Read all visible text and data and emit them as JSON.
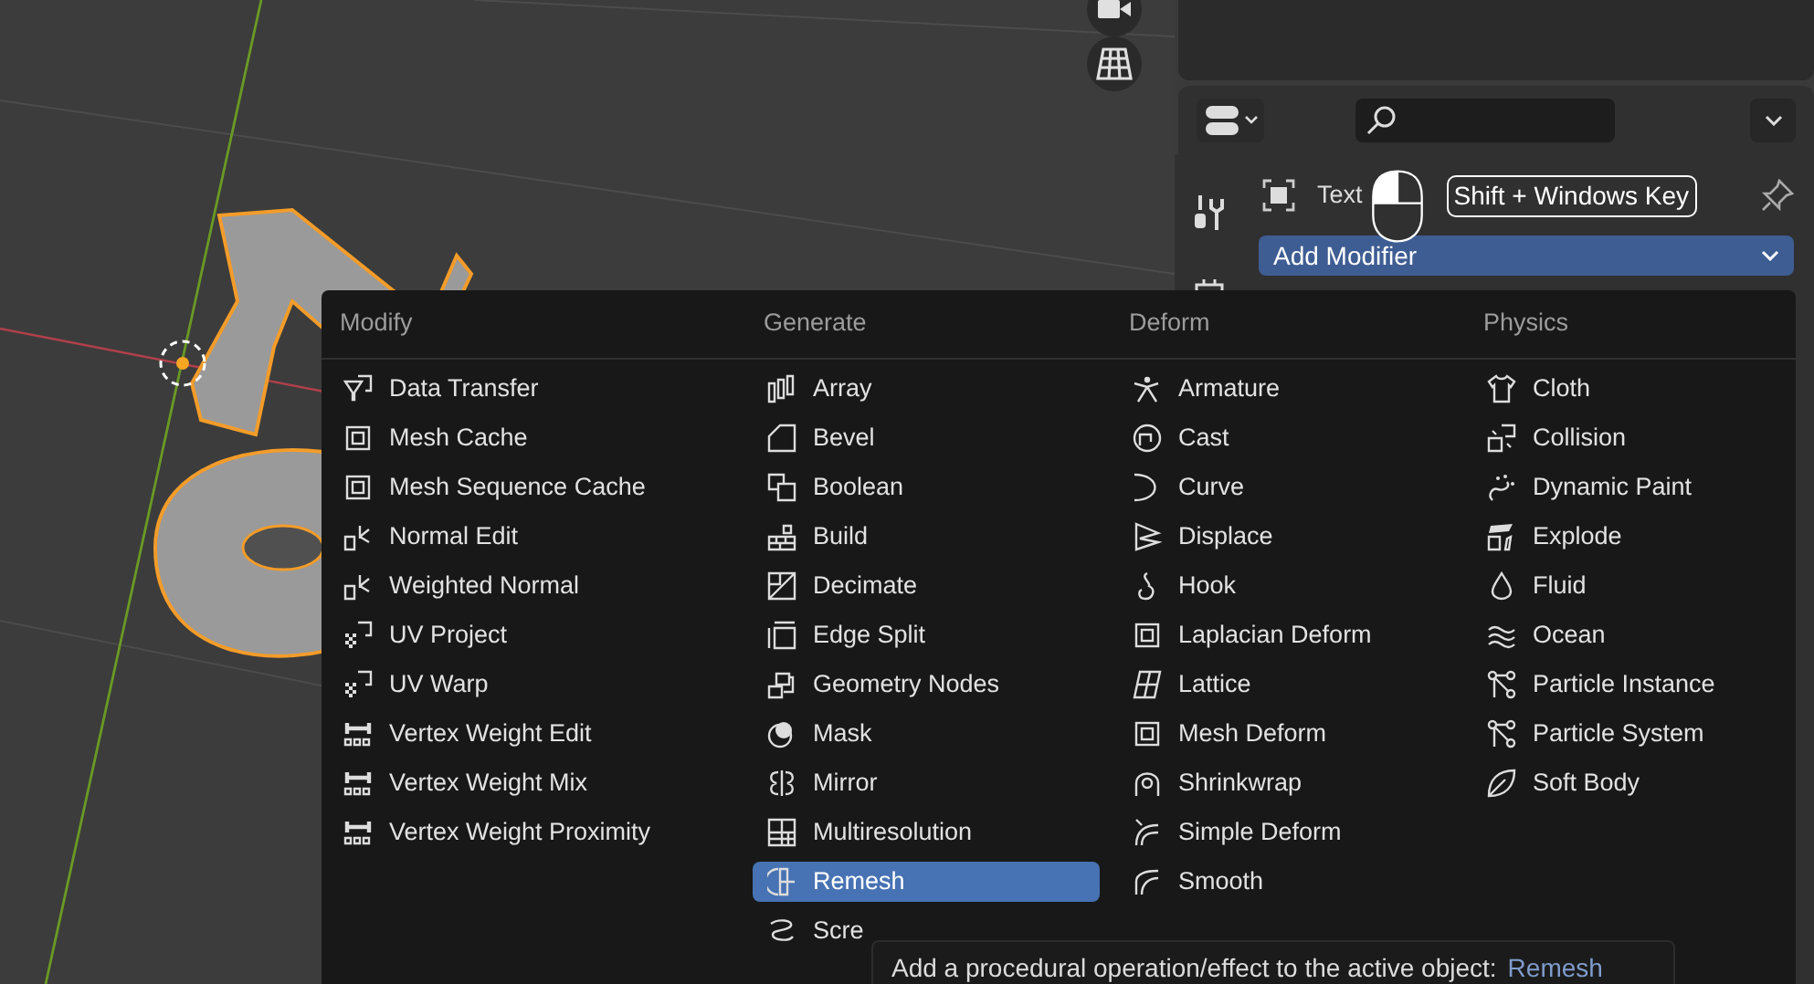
{
  "properties": {
    "object_name": "Text",
    "key_hint": "Shift + Windows Key",
    "add_modifier": "Add Modifier"
  },
  "menu": {
    "columns": [
      {
        "heading": "Modify",
        "items": [
          {
            "label": "Data Transfer",
            "selected": false
          },
          {
            "label": "Mesh Cache",
            "selected": false
          },
          {
            "label": "Mesh Sequence Cache",
            "selected": false
          },
          {
            "label": "Normal Edit",
            "selected": false
          },
          {
            "label": "Weighted Normal",
            "selected": false
          },
          {
            "label": "UV Project",
            "selected": false
          },
          {
            "label": "UV Warp",
            "selected": false
          },
          {
            "label": "Vertex Weight Edit",
            "selected": false
          },
          {
            "label": "Vertex Weight Mix",
            "selected": false
          },
          {
            "label": "Vertex Weight Proximity",
            "selected": false
          }
        ]
      },
      {
        "heading": "Generate",
        "items": [
          {
            "label": "Array",
            "selected": false
          },
          {
            "label": "Bevel",
            "selected": false
          },
          {
            "label": "Boolean",
            "selected": false
          },
          {
            "label": "Build",
            "selected": false
          },
          {
            "label": "Decimate",
            "selected": false
          },
          {
            "label": "Edge Split",
            "selected": false
          },
          {
            "label": "Geometry Nodes",
            "selected": false
          },
          {
            "label": "Mask",
            "selected": false
          },
          {
            "label": "Mirror",
            "selected": false
          },
          {
            "label": "Multiresolution",
            "selected": false
          },
          {
            "label": "Remesh",
            "selected": true
          },
          {
            "label": "Scre",
            "selected": false
          }
        ]
      },
      {
        "heading": "Deform",
        "items": [
          {
            "label": "Armature",
            "selected": false
          },
          {
            "label": "Cast",
            "selected": false
          },
          {
            "label": "Curve",
            "selected": false
          },
          {
            "label": "Displace",
            "selected": false
          },
          {
            "label": "Hook",
            "selected": false
          },
          {
            "label": "Laplacian Deform",
            "selected": false
          },
          {
            "label": "Lattice",
            "selected": false
          },
          {
            "label": "Mesh Deform",
            "selected": false
          },
          {
            "label": "Shrinkwrap",
            "selected": false
          },
          {
            "label": "Simple Deform",
            "selected": false
          },
          {
            "label": "Smooth",
            "selected": false
          }
        ]
      },
      {
        "heading": "Physics",
        "items": [
          {
            "label": "Cloth",
            "selected": false
          },
          {
            "label": "Collision",
            "selected": false
          },
          {
            "label": "Dynamic Paint",
            "selected": false
          },
          {
            "label": "Explode",
            "selected": false
          },
          {
            "label": "Fluid",
            "selected": false
          },
          {
            "label": "Ocean",
            "selected": false
          },
          {
            "label": "Particle Instance",
            "selected": false
          },
          {
            "label": "Particle System",
            "selected": false
          },
          {
            "label": "Soft Body",
            "selected": false
          }
        ]
      }
    ]
  },
  "tooltip": {
    "text": "Add a procedural operation/effect to the active object:",
    "value": "Remesh"
  }
}
